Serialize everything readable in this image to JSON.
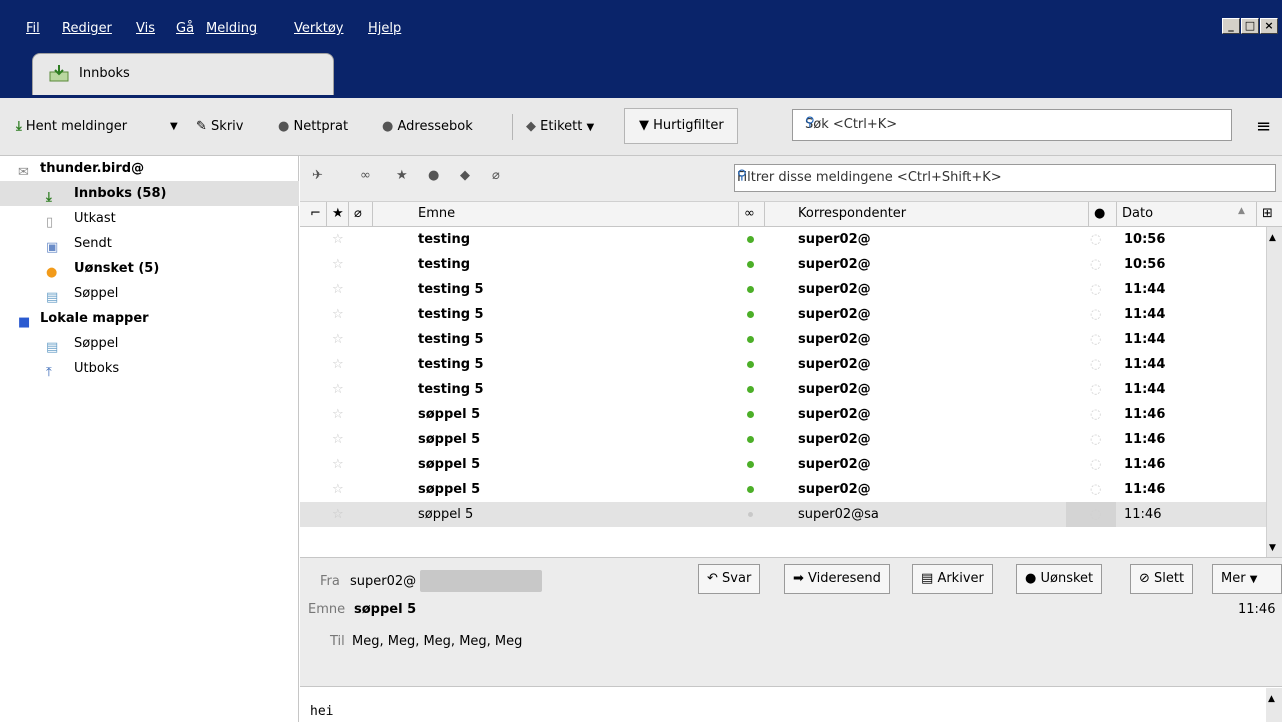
{
  "menu": [
    "Fil",
    "Rediger",
    "Vis",
    "Gå",
    "Melding",
    "Verktøy",
    "Hjelp"
  ],
  "tab": {
    "label": "Innboks"
  },
  "toolbar": {
    "get_messages": "Hent meldinger",
    "write": "Skriv",
    "chat": "Nettprat",
    "address_book": "Adressebok",
    "tag": "Etikett",
    "quick_filter": "Hurtigfilter",
    "search_placeholder": "Søk <Ctrl+K>"
  },
  "folders": {
    "account": "thunder.bird@",
    "items": [
      "Innboks (58)",
      "Utkast",
      "Sendt",
      "Uønsket (5)",
      "Søppel"
    ],
    "local": "Lokale mapper",
    "local_items": [
      "Søppel",
      "Utboks"
    ]
  },
  "filter_placeholder": "Filtrer disse meldingene <Ctrl+Shift+K>",
  "columns": {
    "subject": "Emne",
    "correspondents": "Korrespondenter",
    "date": "Dato"
  },
  "messages": [
    {
      "subject": "testing",
      "from": "super02@",
      "time": "10:56"
    },
    {
      "subject": "testing",
      "from": "super02@",
      "time": "10:56"
    },
    {
      "subject": "testing 5",
      "from": "super02@",
      "time": "11:44"
    },
    {
      "subject": "testing 5",
      "from": "super02@",
      "time": "11:44"
    },
    {
      "subject": "testing 5",
      "from": "super02@",
      "time": "11:44"
    },
    {
      "subject": "testing 5",
      "from": "super02@",
      "time": "11:44"
    },
    {
      "subject": "testing 5",
      "from": "super02@",
      "time": "11:44"
    },
    {
      "subject": "søppel 5",
      "from": "super02@",
      "time": "11:46"
    },
    {
      "subject": "søppel 5",
      "from": "super02@",
      "time": "11:46"
    },
    {
      "subject": "søppel 5",
      "from": "super02@",
      "time": "11:46"
    },
    {
      "subject": "søppel 5",
      "from": "super02@",
      "time": "11:46"
    },
    {
      "subject": "søppel 5",
      "from": "super02@sa",
      "time": "11:46"
    }
  ],
  "header": {
    "from_label": "Fra",
    "from_value": "super02@",
    "subject_label": "Emne",
    "subject_value": "søppel 5",
    "to_label": "Til",
    "to_value": "Meg, Meg, Meg, Meg, Meg",
    "time": "11:46",
    "buttons": {
      "reply": "Svar",
      "forward": "Videresend",
      "archive": "Arkiver",
      "junk": "Uønsket",
      "delete": "Slett",
      "more": "Mer"
    }
  },
  "body": "hei",
  "colors": {
    "menubar": "#0a246a",
    "unread_dot": "#4caf28",
    "selected_row": "#e3e3e3"
  }
}
